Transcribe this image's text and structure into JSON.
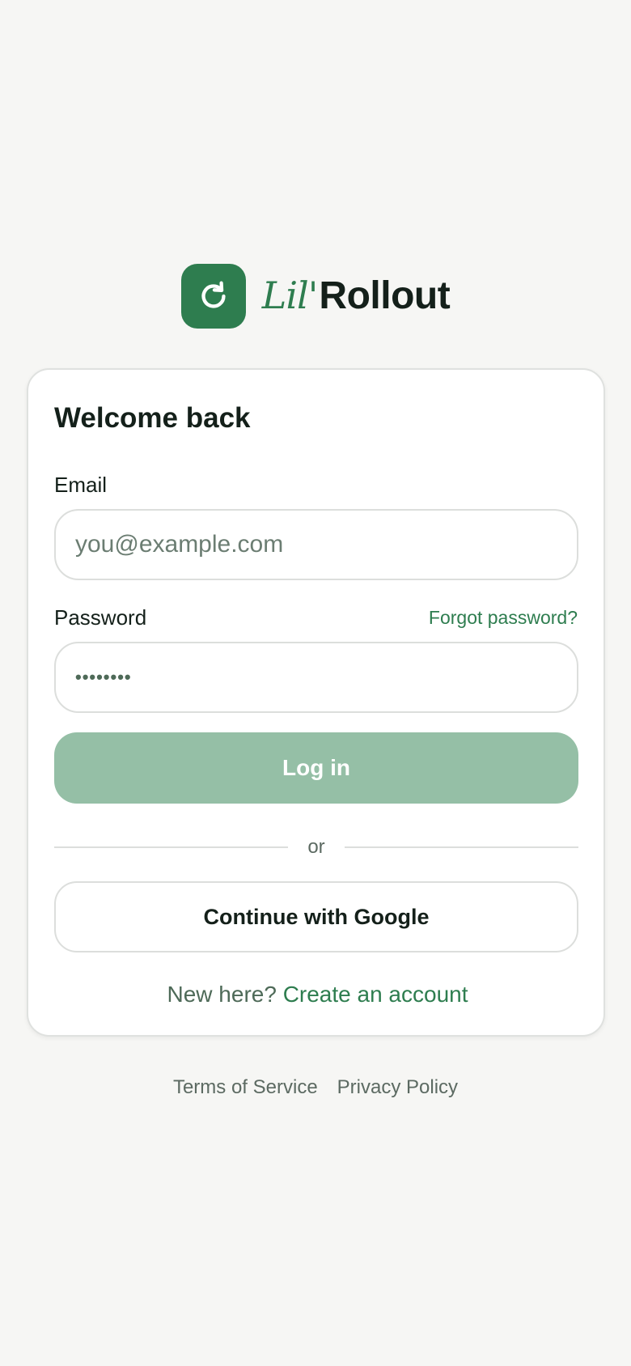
{
  "brand": {
    "name_prefix": "Lil'",
    "name_main": "Rollout",
    "logo_icon": "refresh-icon",
    "accent_color": "#2e7d4f"
  },
  "card": {
    "title": "Welcome back",
    "email": {
      "label": "Email",
      "placeholder": "you@example.com",
      "value": ""
    },
    "password": {
      "label": "Password",
      "masked_value": "••••••••",
      "forgot_link": "Forgot password?"
    },
    "login_button": "Log in",
    "divider_text": "or",
    "google_button": "Continue with Google",
    "signup_prompt": "New here?",
    "signup_link": "Create an account"
  },
  "footer": {
    "terms": "Terms of Service",
    "privacy": "Privacy Policy"
  }
}
